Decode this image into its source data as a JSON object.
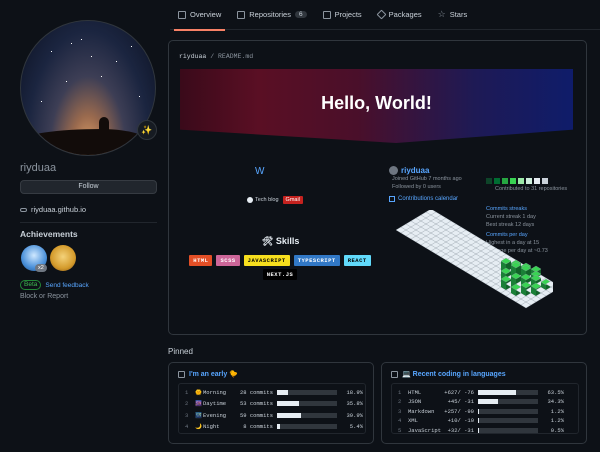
{
  "nav": {
    "tabs": [
      {
        "label": "Overview",
        "active": true
      },
      {
        "label": "Repositories",
        "count": "6"
      },
      {
        "label": "Projects"
      },
      {
        "label": "Packages"
      },
      {
        "label": "Stars"
      }
    ]
  },
  "profile": {
    "username": "riyduaa",
    "follow_label": "Follow",
    "website": "riyduaa.github.io",
    "status_emoji": "✨",
    "achievements_title": "Achievements",
    "achievement_count": "x2",
    "beta_label": "Beta",
    "feedback_label": "Send feedback",
    "block_label": "Block or Report"
  },
  "readme": {
    "path_user": "riyduaa",
    "path_sep": "/",
    "path_file": "README.md",
    "banner_text": "Hello, World!",
    "w_logo": "W",
    "tech_blog_label": "Tech blog",
    "gmail_label": "Gmail",
    "skills_title": "🛠 Skills",
    "skills": [
      {
        "label": "HTML",
        "color": "#e34f26",
        "text": "#ffffff"
      },
      {
        "label": "SCSS",
        "color": "#cc6699",
        "text": "#ffffff"
      },
      {
        "label": "JAVASCRIPT",
        "color": "#f7df1e",
        "text": "#000000"
      },
      {
        "label": "TYPESCRIPT",
        "color": "#3178c6",
        "text": "#ffffff"
      },
      {
        "label": "REACT",
        "color": "#61dafb",
        "text": "#000000"
      },
      {
        "label": "NEXT.JS",
        "color": "#000000",
        "text": "#ffffff"
      }
    ],
    "stats": {
      "name": "riyduaa",
      "joined": "Joined GitHub 7 months ago",
      "followed": "Followed by 0 users",
      "contributions_label": "Contributions calendar",
      "contributed_to": "Contributed to 31 repositories",
      "commits_streaks": "Commits streaks",
      "current_streak": "Current streak 1 day",
      "best_streak": "Best streak 12 days",
      "commits_per_day": "Commits per day",
      "highest": "Highest in a day at 15",
      "average": "Average per day at ~0.73"
    }
  },
  "pinned": {
    "title": "Pinned",
    "cards": [
      {
        "title": "I'm an early 🐤",
        "rows": [
          {
            "n": "1",
            "icon": "🌞",
            "label": "Morning",
            "value": "28 commits",
            "pct": "18.9%",
            "fill": 0.19
          },
          {
            "n": "2",
            "icon": "🌆",
            "label": "Daytime",
            "value": "53 commits",
            "pct": "35.8%",
            "fill": 0.36
          },
          {
            "n": "3",
            "icon": "🌃",
            "label": "Evening",
            "value": "59 commits",
            "pct": "39.9%",
            "fill": 0.4
          },
          {
            "n": "4",
            "icon": "🌙",
            "label": "Night",
            "value": "8 commits",
            "pct": "5.4%",
            "fill": 0.05
          }
        ]
      },
      {
        "title": "💻 Recent coding in languages",
        "rows": [
          {
            "n": "1",
            "icon": "",
            "label": "HTML",
            "value": "+627/  -76",
            "pct": "63.5%",
            "fill": 0.64
          },
          {
            "n": "2",
            "icon": "",
            "label": "JSON",
            "value": "+45/  -31",
            "pct": "34.3%",
            "fill": 0.34
          },
          {
            "n": "3",
            "icon": "",
            "label": "Markdown",
            "value": "+257/  -90",
            "pct": "1.2%",
            "fill": 0.01
          },
          {
            "n": "4",
            "icon": "",
            "label": "XML",
            "value": "+10/  -10",
            "pct": "1.2%",
            "fill": 0.01
          },
          {
            "n": "5",
            "icon": "",
            "label": "JavaScript",
            "value": "+32/  -31",
            "pct": "0.5%",
            "fill": 0.005
          }
        ]
      }
    ]
  }
}
